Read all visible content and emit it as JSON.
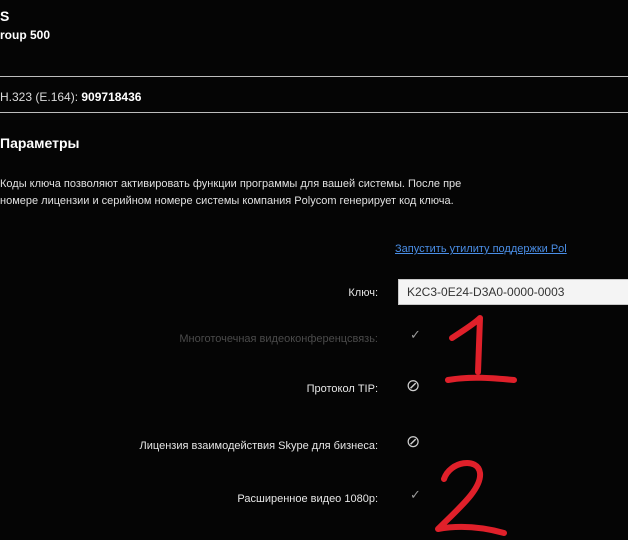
{
  "header": {
    "title": "S",
    "subtitle": "roup 500"
  },
  "h323": {
    "label": "H.323 (E.164): ",
    "value": "909718436"
  },
  "section": {
    "title": "Параметры",
    "description_line1": "Коды ключа позволяют активировать функции программы для вашей системы. После пре",
    "description_line2": "номере лицензии и серийном номере системы компания Polycom генерирует код ключа."
  },
  "support_link": "Запустить утилиту поддержки Pol",
  "key": {
    "label": "Ключ:",
    "value": "K2C3-0E24-D3A0-0000-0003"
  },
  "features": [
    {
      "label": "Многоточечная видеоконференцсвязь:",
      "status_icon": "checkmark-icon",
      "symbol": "✓"
    },
    {
      "label": "Протокол TIP:",
      "status_icon": "not-available-icon",
      "symbol": "⊘"
    },
    {
      "label": "Лицензия взаимодействия Skype для бизнеса:",
      "status_icon": "not-available-icon",
      "symbol": "⊘"
    },
    {
      "label": "Расширенное видео 1080p:",
      "status_icon": "checkmark-icon",
      "symbol": "✓"
    }
  ],
  "annotations": [
    "1",
    "2"
  ],
  "colors": {
    "background": "#050505",
    "link": "#4a8ee6",
    "annotation": "#e0202a"
  }
}
